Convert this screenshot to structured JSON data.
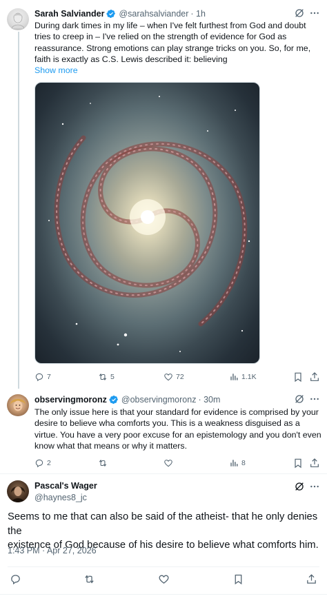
{
  "tweets": [
    {
      "name": "Sarah Salviander",
      "handle": "@sarahsalviander",
      "time": "· 1h",
      "lines": [
        "During dark times in my life – when I've felt furthest from God and doubt",
        "tries to creep in – I've relied on the strength of evidence for God as",
        "reassurance. Strong emotions can play strange tricks on you. So, for me,",
        "faith is exactly as C.S. Lewis described it: believing"
      ],
      "show_more": "Show more",
      "stats": {
        "replies": "7",
        "reposts": "5",
        "likes": "72",
        "views": "1.1K"
      }
    },
    {
      "name": "observingmoronz",
      "handle": "@observingmoronz",
      "time": "· 30m",
      "lines": [
        "The only issue here is that your standard for evidence is comprised by your",
        "desire to believe wha comforts you. This is a weakness disguised as a",
        "virtue. You have a very poor excuse for an epistemology and you don't even",
        "know what that means or why it matters."
      ],
      "stats": {
        "replies": "2",
        "views": "8"
      }
    }
  ],
  "main": {
    "name": "Pascal's Wager",
    "handle": "@haynes8_jc",
    "lines": [
      "Seems to me that can also be said of the atheist- that he only denies the",
      "existence of God because of his desire to believe what comforts him."
    ],
    "timestamp": "1:43 PM · Apr 27, 2026"
  },
  "colors": {
    "accent": "#1d9bf0",
    "muted": "#536471",
    "text": "#0f1419"
  },
  "icons": [
    "verified-badge-icon",
    "grok-icon",
    "more-icon",
    "reply-icon",
    "repost-icon",
    "like-icon",
    "views-icon",
    "bookmark-icon",
    "share-icon"
  ]
}
